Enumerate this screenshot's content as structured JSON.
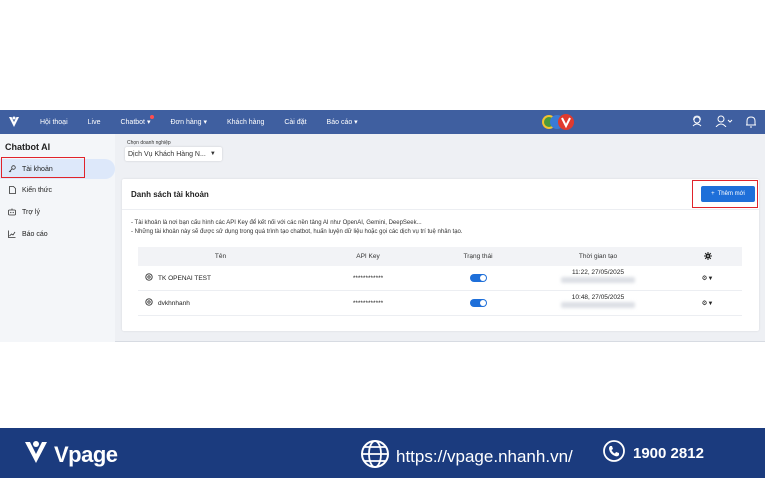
{
  "nav": {
    "items": [
      {
        "label": "Hội thoại"
      },
      {
        "label": "Live"
      },
      {
        "label": "Chatbot ▾"
      },
      {
        "label": "Đơn hàng ▾"
      },
      {
        "label": "Khách hàng"
      },
      {
        "label": "Cài đặt"
      },
      {
        "label": "Báo cáo ▾"
      }
    ],
    "accent": "#3f5fa0"
  },
  "sidebar": {
    "title": "Chatbot AI",
    "items": [
      {
        "label": "Tài khoản",
        "icon": "key-icon"
      },
      {
        "label": "Kiến thức",
        "icon": "document-icon"
      },
      {
        "label": "Trợ lý",
        "icon": "assistant-icon"
      },
      {
        "label": "Báo cáo",
        "icon": "chart-icon"
      }
    ]
  },
  "business_select": {
    "label": "Chọn doanh nghiệp",
    "value": "Dịch Vụ Khách Hàng N..."
  },
  "card": {
    "title": "Danh sách tài khoản",
    "add_button": "Thêm mới",
    "notes": [
      "- Tài khoản là nơi bạn cấu hình các API Key để kết nối với các nền tảng AI như OpenAI, Gemini, DeepSeek...",
      "- Những tài khoản này sẽ được sử dụng trong quá trình tạo chatbot, huấn luyện dữ liệu hoặc gọi các dịch vụ trí tuệ nhân tạo."
    ],
    "table": {
      "headers": [
        "Tên",
        "API Key",
        "Trạng thái",
        "Thời gian tạo"
      ],
      "rows": [
        {
          "name": "TK OPENAI TEST",
          "api_key": "************",
          "status": "on",
          "time": "11:22, 27/05/2025"
        },
        {
          "name": "dvkhnhanh",
          "api_key": "************",
          "status": "on",
          "time": "10:48, 27/05/2025"
        }
      ]
    }
  },
  "footer": {
    "brand": "Vpage",
    "website": "https://vpage.nhanh.vn/",
    "phone": "1900 2812",
    "background": "#1b3b7e"
  }
}
